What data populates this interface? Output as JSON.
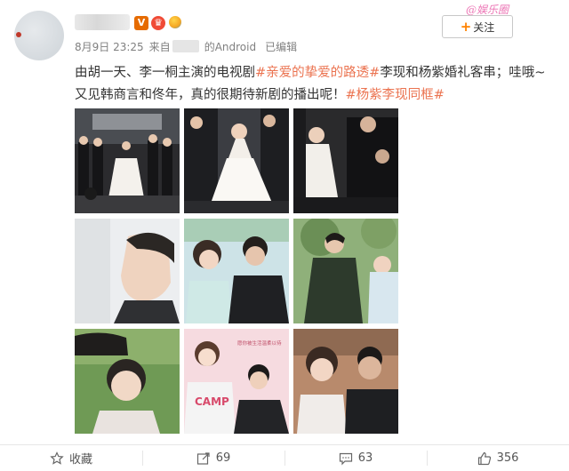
{
  "post": {
    "date": "8月9日 23:25",
    "source_prefix": "来自",
    "source_suffix": "的Android",
    "edited": "已编辑",
    "follow_label": "关注",
    "watermark": "@娱乐圈",
    "text": {
      "part1": "由胡一天、李一桐主演的电视剧",
      "tag1": "#亲爱的挚爱的路透#",
      "part2": "李现和杨紫婚礼客串；哇哦~又见韩商言和佟年，真的很期待新剧的播出呢！",
      "tag2": "#杨紫李现同框#"
    },
    "photo_captions": {
      "poster_line1": "愿你被生活温柔以待",
      "poster_line2": "CAMP"
    }
  },
  "actions": [
    {
      "icon": "star-icon",
      "label": "收藏"
    },
    {
      "icon": "share-icon",
      "label": "69"
    },
    {
      "icon": "comment-icon",
      "label": "63"
    },
    {
      "icon": "thumbs-up-icon",
      "label": "356"
    }
  ],
  "colors": {
    "hashtag": "#eb7350",
    "follow_plus": "#ff8200",
    "meta_text": "#808080",
    "v_badge": "#e66b00"
  }
}
